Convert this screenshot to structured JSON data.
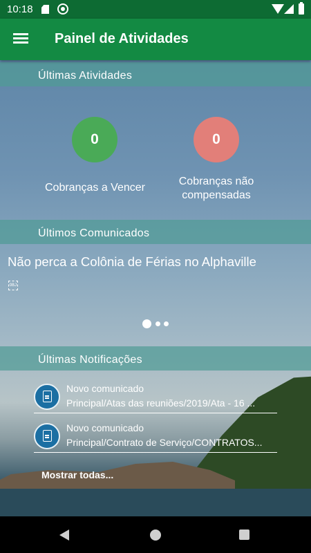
{
  "status_bar": {
    "time": "10:18"
  },
  "app_bar": {
    "title": "Painel de Atividades",
    "menu_icon": "menu-icon"
  },
  "colors": {
    "status_bar": "#0d6b33",
    "app_bar": "#138a43",
    "section_header": "#509b96",
    "counter_green": "#4aaa57",
    "counter_red": "#e27f79",
    "notification_icon": "#1b6fa3"
  },
  "activities": {
    "header": "Últimas Atividades",
    "counters": [
      {
        "value": "0",
        "label": "Cobranças a Vencer",
        "color": "#4aaa57"
      },
      {
        "value": "0",
        "label": "Cobranças não compensadas",
        "color": "#e27f79"
      }
    ]
  },
  "communiques": {
    "header": "Últimos Comunicados",
    "current_title": "Não perca a Colônia de Férias no Alphaville",
    "pager": {
      "pages": 3,
      "active": 1
    }
  },
  "notifications": {
    "header": "Últimas Notificações",
    "items": [
      {
        "title": "Novo comunicado",
        "path": "Principal/Atas das reuniões/2019/Ata - 16 ...",
        "icon": "document-icon"
      },
      {
        "title": "Novo comunicado",
        "path": "Principal/Contrato de Serviço/CONTRATOS...",
        "icon": "document-icon"
      }
    ],
    "show_all": "Mostrar todas..."
  }
}
